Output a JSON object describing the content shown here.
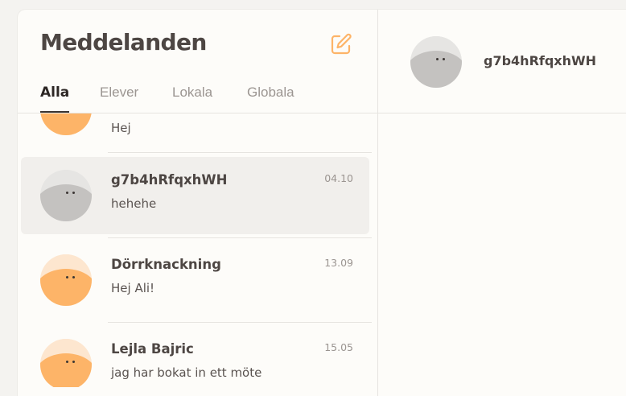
{
  "header": {
    "title": "Meddelanden",
    "compose_icon": "edit-icon"
  },
  "tabs": [
    {
      "label": "Alla",
      "active": true
    },
    {
      "label": "Elever",
      "active": false
    },
    {
      "label": "Lokala",
      "active": false
    },
    {
      "label": "Globala",
      "active": false
    }
  ],
  "conversations": [
    {
      "name": "",
      "preview": "Hej",
      "time": "",
      "avatar_color": "orange"
    },
    {
      "name": "g7b4hRfqxhWH",
      "preview": "hehehe",
      "time": "04.10",
      "avatar_color": "gray",
      "selected": true
    },
    {
      "name": "Dörrknackning",
      "preview": "Hej Ali!",
      "time": "13.09",
      "avatar_color": "orange"
    },
    {
      "name": "Lejla Bajric",
      "preview": "jag har bokat in ett möte",
      "time": "15.05",
      "avatar_color": "orange"
    }
  ],
  "active_chat": {
    "name": "g7b4hRfqxhWH",
    "avatar_color": "gray"
  },
  "colors": {
    "accent": "#fdb468",
    "background": "#fdfcf9",
    "selected": "#f1efec"
  }
}
